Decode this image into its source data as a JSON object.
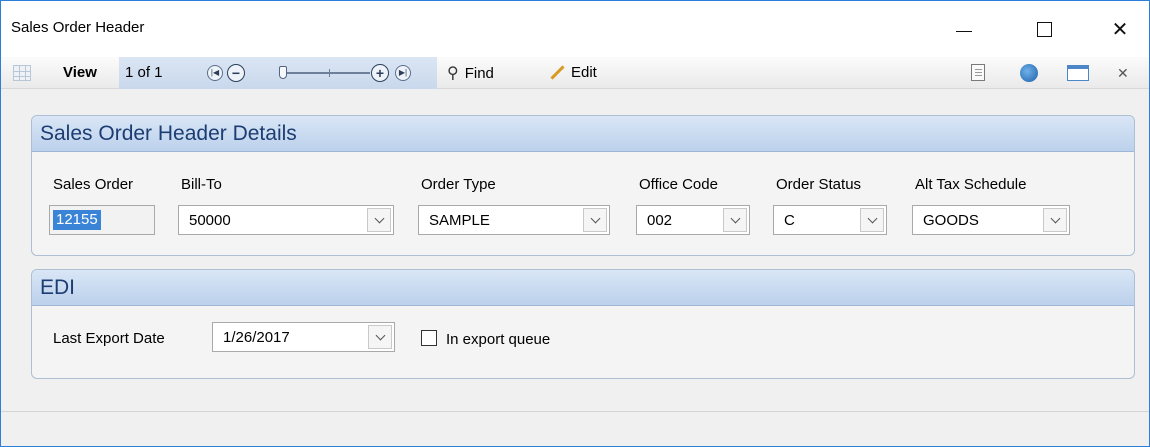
{
  "window": {
    "title": "Sales Order Header",
    "minimize_icon": "minimize-icon",
    "maximize_icon": "maximize-icon",
    "close_glyph": "✕"
  },
  "toolbar": {
    "view_label": "View",
    "pager_text": "1 of 1",
    "find_label": "Find",
    "edit_label": "Edit",
    "icons": [
      "grid-icon",
      "first-page-icon",
      "zoom-out-icon",
      "zoom-in-icon",
      "last-page-icon",
      "binoculars-icon",
      "pencil-icon",
      "document-icon",
      "globe-icon",
      "panel-icon",
      "close-icon"
    ],
    "close_glyph": "✕",
    "accent": "#c9d8ec"
  },
  "details": {
    "title": "Sales Order Header Details",
    "sales_order": {
      "label": "Sales Order",
      "value": "12155"
    },
    "bill_to": {
      "label": "Bill-To",
      "value": "50000"
    },
    "order_type": {
      "label": "Order Type",
      "value": "SAMPLE"
    },
    "office_code": {
      "label": "Office Code",
      "value": "002"
    },
    "order_status": {
      "label": "Order Status",
      "value": "C"
    },
    "alt_tax_schedule": {
      "label": "Alt Tax Schedule",
      "value": "GOODS"
    }
  },
  "edi": {
    "title": "EDI",
    "last_export_date": {
      "label": "Last Export Date",
      "value": "1/26/2017"
    },
    "in_export_queue": {
      "label": "In export queue",
      "checked": false
    }
  },
  "colors": {
    "group_header": "#bcd1ec",
    "group_title": "#1c3d72",
    "selection": "#3a84d8",
    "window_border": "#2b7fd8"
  }
}
